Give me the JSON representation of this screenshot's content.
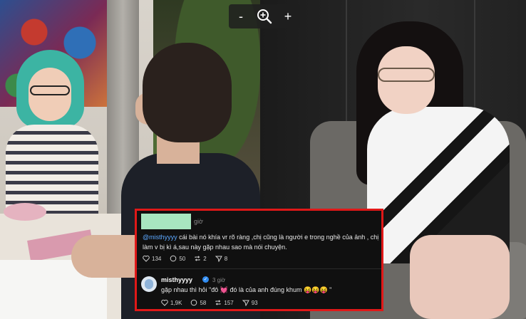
{
  "zoom_toolbar": {
    "zoom_out_label": "-",
    "zoom_in_label": "+"
  },
  "comments": [
    {
      "time": "giờ",
      "mention": "@misthyyyy",
      "text": " cái bài nó khía vr rõ ràng ,chị cũng là người e trong nghề của ảnh , chị làm v bị kì á,sau này gặp nhau sao mà nói chuyện.",
      "likes": "134",
      "replies": "50",
      "reposts": "2",
      "shares": "8"
    },
    {
      "username": "misthyyyy",
      "time": "3 giờ",
      "text": "gặp nhau thì hỏi \"đô 💓 đó là của anh đúng khum 😝😝😝 \"",
      "likes": "1,9K",
      "replies": "58",
      "reposts": "157",
      "shares": "93"
    }
  ],
  "colors": {
    "highlight_border": "#e01818",
    "mention": "#5da8ff",
    "verified": "#2f8bf0"
  }
}
